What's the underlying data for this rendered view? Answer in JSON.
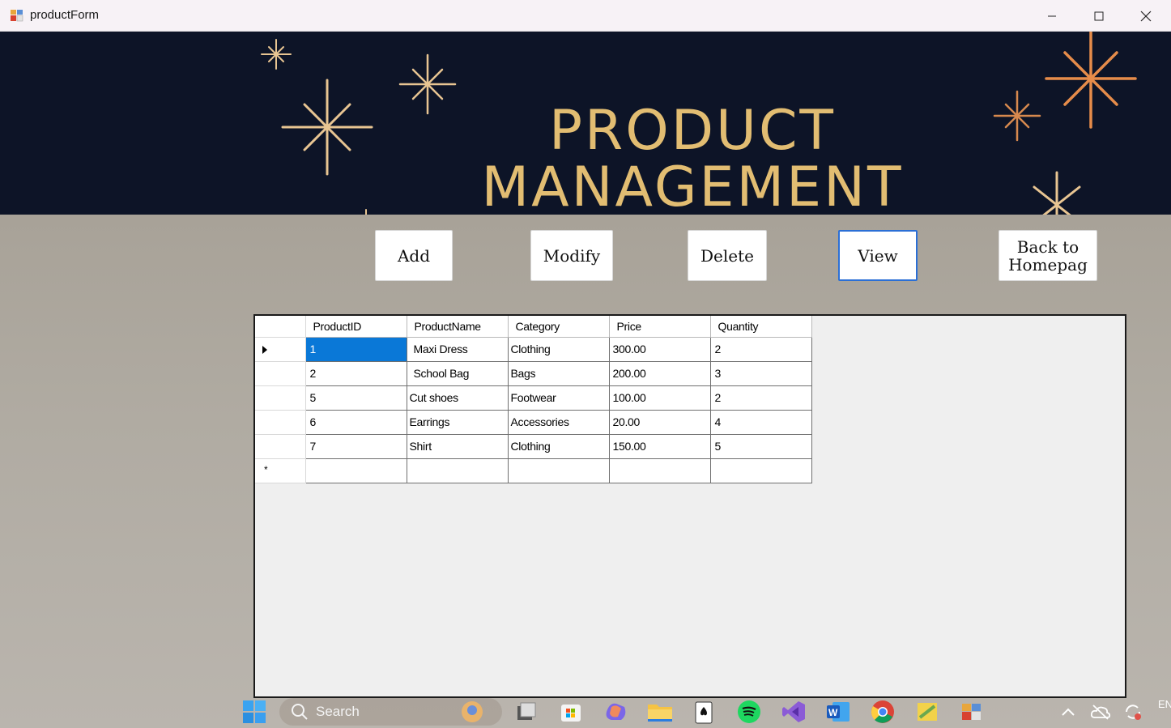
{
  "window": {
    "title": "productForm",
    "app_icon": "form-app-icon",
    "controls": [
      "minimize-icon",
      "maximize-icon",
      "close-icon"
    ]
  },
  "banner": {
    "line1": "PRODUCT",
    "line2": "MANAGEMENT",
    "text_color": "#e2bd72",
    "background": "#0d1427"
  },
  "actions": {
    "add": "Add",
    "modify": "Modify",
    "delete": "Delete",
    "view": "View",
    "back_line1": "Back to",
    "back_line2": "Homepag"
  },
  "grid": {
    "columns": [
      "ProductID",
      "ProductName",
      "Category",
      "Price",
      "Quantity"
    ],
    "rows": [
      [
        "1",
        "Maxi Dress",
        "Clothing",
        "300.00",
        "2"
      ],
      [
        "2",
        "School Bag",
        "Bags",
        "200.00",
        "3"
      ],
      [
        "5",
        "Cut shoes",
        "Footwear",
        "100.00",
        "2"
      ],
      [
        "6",
        "Earrings",
        "Accessories",
        "20.00",
        "4"
      ],
      [
        "7",
        "Shirt",
        "Clothing",
        "150.00",
        "5"
      ]
    ],
    "new_row_marker": "*",
    "selected_color": "#0a78d7"
  },
  "taskbar": {
    "search_label": "Search",
    "language": "EN",
    "apps": [
      "start-icon",
      "search-icon",
      "task-view-icon",
      "store-icon",
      "copilot-icon",
      "file-explorer-icon",
      "solitaire-icon",
      "spotify-icon",
      "visual-studio-icon",
      "word-icon",
      "chrome-icon",
      "app-icon",
      "form-app-icon"
    ]
  }
}
